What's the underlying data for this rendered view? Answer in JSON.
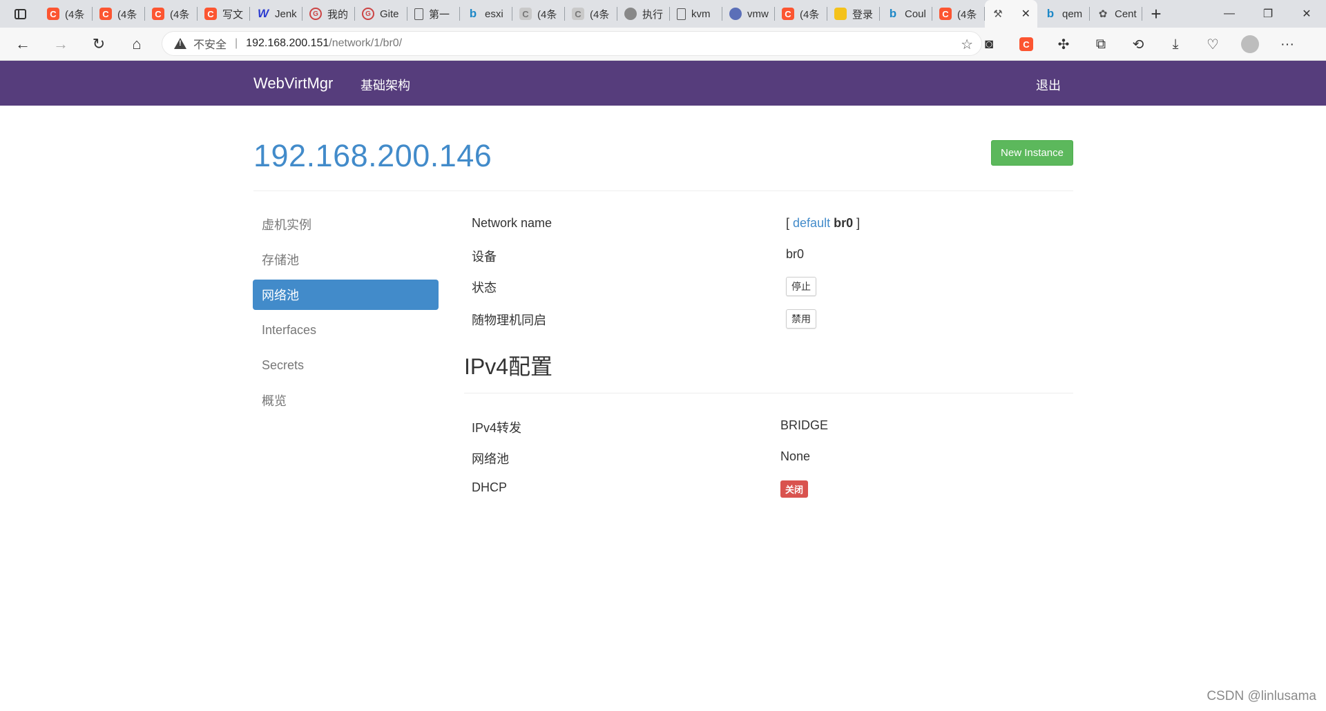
{
  "browser": {
    "tabs": [
      {
        "icon": "csdn-icon",
        "label": "(4条"
      },
      {
        "icon": "csdn-icon",
        "label": "(4条"
      },
      {
        "icon": "csdn-icon",
        "label": "(4条"
      },
      {
        "icon": "csdn-icon",
        "label": "写文"
      },
      {
        "icon": "w-icon",
        "label": "Jenk"
      },
      {
        "icon": "gitee-icon",
        "label": "我的"
      },
      {
        "icon": "gitee-icon",
        "label": "Gite"
      },
      {
        "icon": "document-icon",
        "label": "第一"
      },
      {
        "icon": "bing-icon",
        "label": "esxi"
      },
      {
        "icon": "csdn-icon",
        "label": "(4条"
      },
      {
        "icon": "csdn-icon",
        "label": "(4条"
      },
      {
        "icon": "avatar-icon",
        "label": "执行"
      },
      {
        "icon": "document-icon",
        "label": "kvm"
      },
      {
        "icon": "paw-icon",
        "label": "vmw"
      },
      {
        "icon": "csdn-icon",
        "label": "(4条"
      },
      {
        "icon": "python-icon",
        "label": "登录"
      },
      {
        "icon": "bing-icon",
        "label": "Coul"
      },
      {
        "icon": "csdn-icon",
        "label": "(4条"
      }
    ],
    "tabs_after": [
      {
        "icon": "bing-icon",
        "label": "qem"
      },
      {
        "icon": "centos-icon",
        "label": "Cent"
      }
    ],
    "insecure_label": "不安全",
    "url_host": "192.168.200.151",
    "url_path": "/network/1/br0/"
  },
  "appbar": {
    "brand": "WebVirtMgr",
    "infra": "基础架构",
    "logout": "退出"
  },
  "page": {
    "title": "192.168.200.146",
    "new_instance": "New Instance"
  },
  "sidebar": {
    "items": [
      {
        "label": "虚机实例"
      },
      {
        "label": "存储池"
      },
      {
        "label": "网络池"
      },
      {
        "label": "Interfaces"
      },
      {
        "label": "Secrets"
      },
      {
        "label": "概览"
      }
    ],
    "active_index": 2
  },
  "network": {
    "name_label": "Network name",
    "name_open": "[",
    "name_link": "default",
    "name_current": "br0",
    "name_close": "]",
    "device_label": "设备",
    "device_value": "br0",
    "state_label": "状态",
    "state_button": "停止",
    "autostart_label": "随物理机同启",
    "autostart_button": "禁用"
  },
  "ipv4": {
    "section_title": "IPv4配置",
    "forward_label": "IPv4转发",
    "forward_value": "BRIDGE",
    "pool_label": "网络池",
    "pool_value": "None",
    "dhcp_label": "DHCP",
    "dhcp_value": "关闭"
  },
  "watermark": "CSDN @linlusama"
}
